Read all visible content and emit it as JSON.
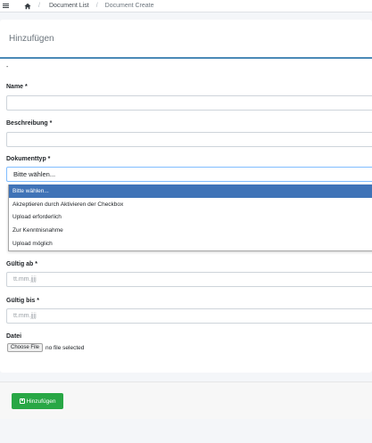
{
  "breadcrumb": {
    "items": [
      "Document List",
      "Document Create"
    ]
  },
  "card": {
    "title": "Hinzufügen",
    "dash": "-"
  },
  "form": {
    "name_label": "Name *",
    "name_value": "",
    "beschreibung_label": "Beschreibung *",
    "beschreibung_value": "",
    "dokumenttyp_label": "Dokumenttyp *",
    "dokumenttyp_selected": "Bitte wählen...",
    "dokumenttyp_options": [
      "Bitte wählen...",
      "Akzeptieren durch Aktivieren der Checkbox",
      "Upload erforderlich",
      "Zur Kenntnisnahme",
      "Upload möglich"
    ],
    "gueltig_ab_label": "Gültig ab *",
    "gueltig_ab_placeholder": "tt.mm.jjjj",
    "gueltig_bis_label": "Gültig bis *",
    "gueltig_bis_placeholder": "tt.mm.jjjj",
    "datei_label": "Datei",
    "file_button": "Choose File",
    "file_status": "no file selected"
  },
  "footer": {
    "submit_label": "Hinzufügen"
  },
  "colors": {
    "accent": "#4a8ab7",
    "selected_option": "#3f73b7",
    "submit": "#28a745"
  },
  "icons": [
    "menu-icon",
    "home-icon",
    "save-icon"
  ]
}
